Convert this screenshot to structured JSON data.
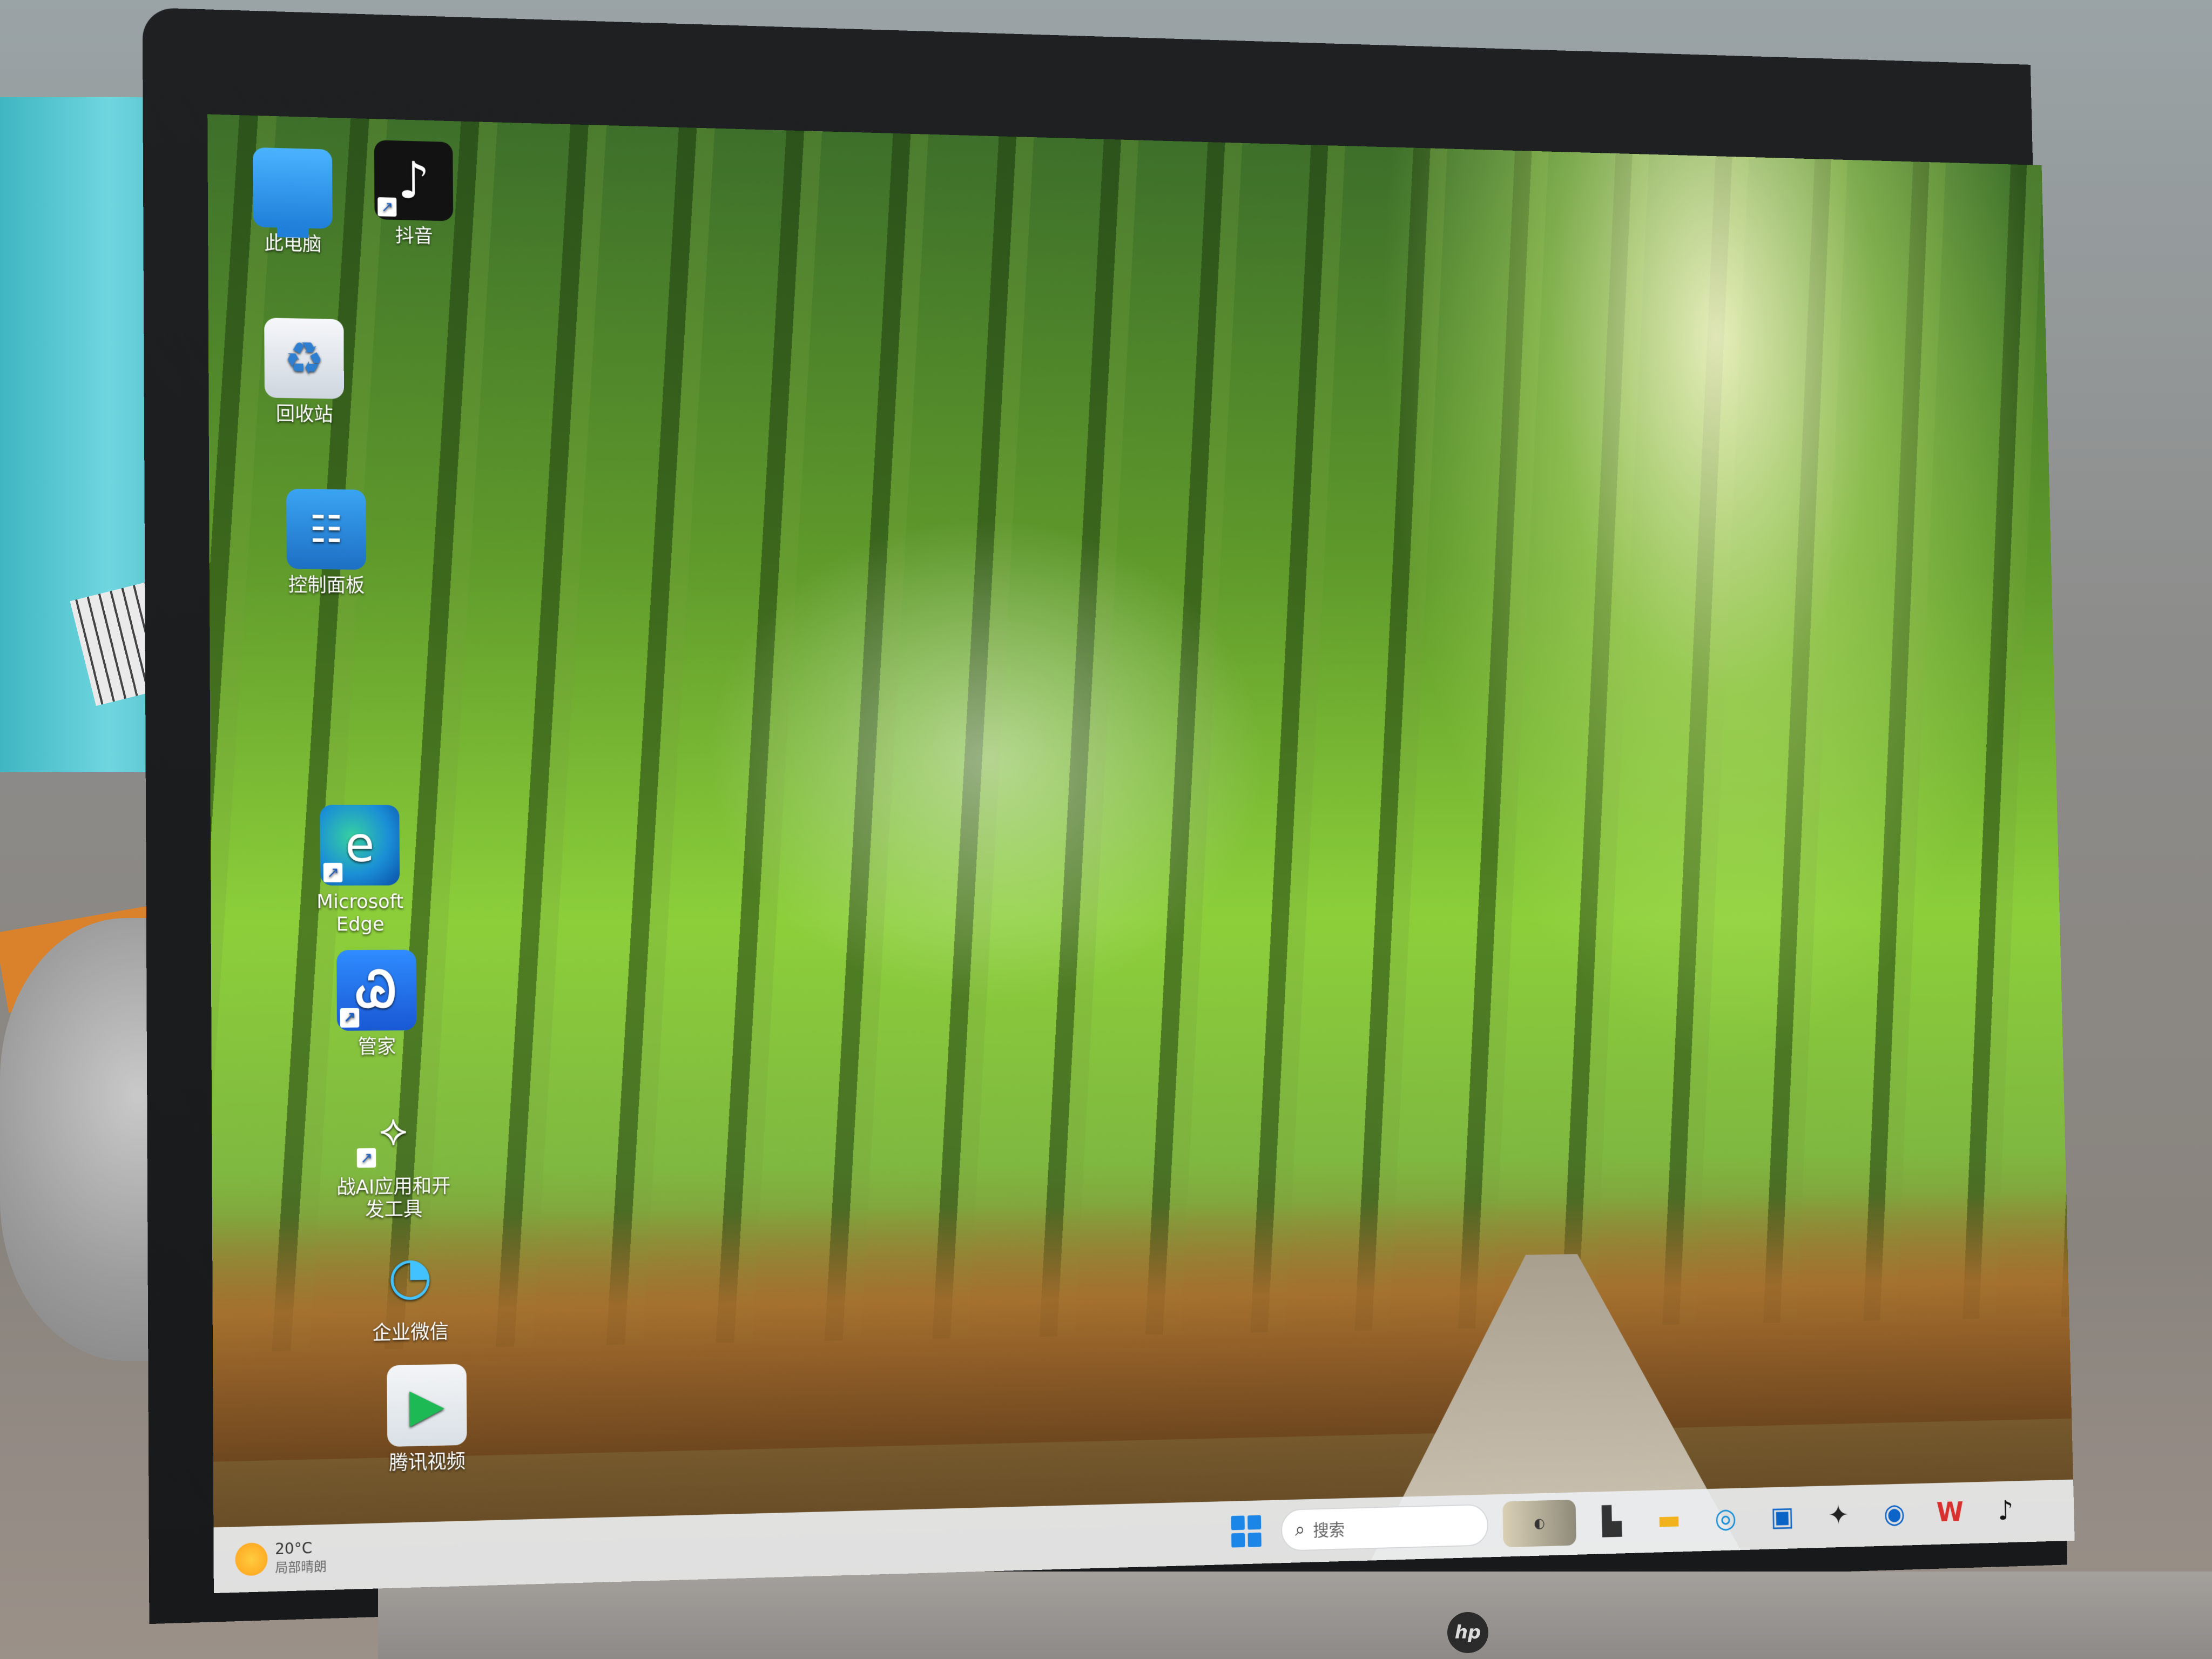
{
  "desktop": {
    "icons": [
      {
        "label": "此电脑",
        "icon": "computer-icon"
      },
      {
        "label": "抖音",
        "icon": "douyin-icon"
      },
      {
        "label": "回收站",
        "icon": "recycle-bin-icon"
      },
      {
        "label": "控制面板",
        "icon": "control-panel-icon"
      },
      {
        "label": "Microsoft Edge",
        "icon": "edge-icon"
      },
      {
        "label": "管家",
        "icon": "pc-manager-icon"
      },
      {
        "label": "战AI应用和开发工具",
        "icon": "ai-tools-icon"
      },
      {
        "label": "企业微信",
        "icon": "wecom-icon"
      },
      {
        "label": "腾讯视频",
        "icon": "tencent-video-icon"
      }
    ]
  },
  "taskbar": {
    "weather": {
      "temp": "20°C",
      "desc": "局部晴朗"
    },
    "search_placeholder": "搜索",
    "apps": [
      "widgets",
      "file-explorer-dark",
      "file-explorer",
      "edge",
      "microsoft-store",
      "copilot",
      "hp",
      "wps",
      "douyin"
    ]
  },
  "device": {
    "logo_text": "hp"
  },
  "colors": {
    "taskbar_bg": "#eceef0",
    "start_blue": "#1c86e8",
    "bamboo_green": "#8ccf3a"
  }
}
